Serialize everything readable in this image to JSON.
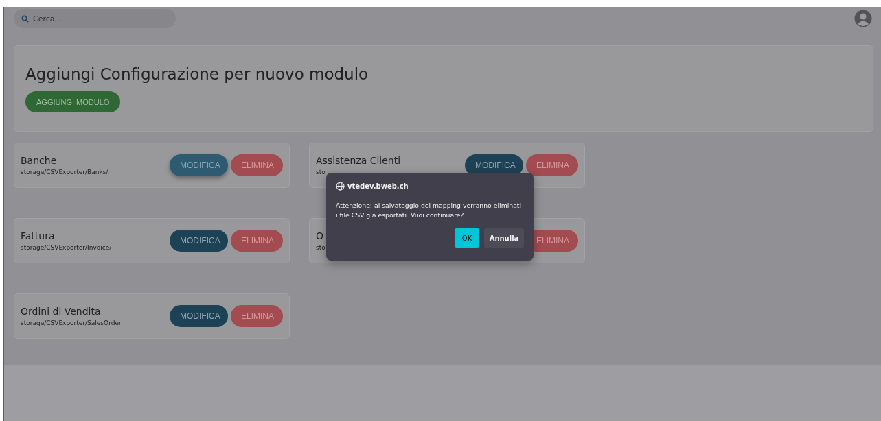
{
  "search": {
    "placeholder": "Cerca..."
  },
  "header": {
    "title": "Aggiungi Configurazione per nuovo modulo",
    "button": "AGGIUNGI MODULO"
  },
  "modules": [
    {
      "title": "Banche",
      "path": "storage/CSVExporter/Banks/",
      "buttons": [
        {
          "kind": "edit",
          "label": "MODIFICA",
          "focused": true
        },
        {
          "kind": "delete",
          "label": "ELIMINA",
          "focused": false
        }
      ]
    },
    {
      "title": "Assistenza Clienti",
      "path": "sto",
      "buttons": [
        {
          "kind": "edit",
          "label": "MODIFICA",
          "focused": false
        },
        {
          "kind": "delete",
          "label": "ELIMINA",
          "focused": false
        }
      ]
    },
    {
      "title": "Fattura",
      "path": "storage/CSVExporter/Invoice/",
      "buttons": [
        {
          "kind": "edit",
          "label": "MODIFICA",
          "focused": false
        },
        {
          "kind": "delete",
          "label": "ELIMINA",
          "focused": false
        }
      ]
    },
    {
      "title": "O",
      "path": "sto",
      "buttons": [
        {
          "kind": "hidden"
        },
        {
          "kind": "delete",
          "label": "ELIMINA",
          "focused": false
        }
      ]
    },
    {
      "title": "Ordini di Vendita",
      "path": "storage/CSVExporter/SalesOrder",
      "buttons": [
        {
          "kind": "edit",
          "label": "MODIFICA",
          "focused": false
        },
        {
          "kind": "delete",
          "label": "ELIMINA",
          "focused": false
        }
      ]
    }
  ],
  "dialog": {
    "origin": "vtedev.bweb.ch",
    "message": "Attenzione: al salvataggio del mapping verranno eliminati i file CSV già esportati. Vuoi continuare?",
    "buttons": [
      {
        "kind": "primary",
        "label": "OK"
      },
      {
        "kind": "secondary",
        "label": "Annulla"
      }
    ]
  }
}
